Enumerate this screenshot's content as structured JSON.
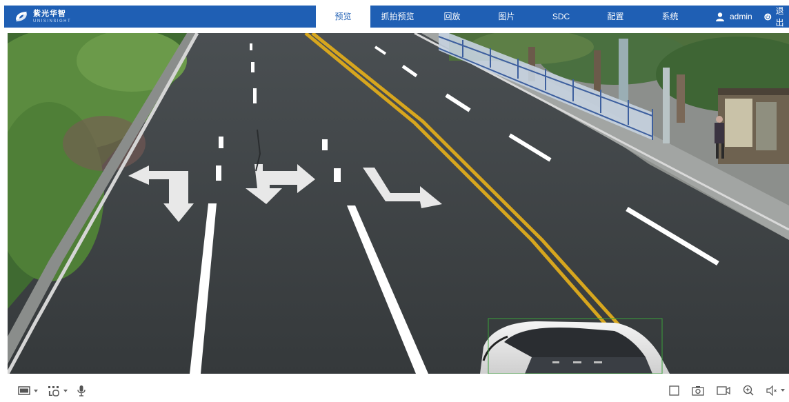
{
  "brand": {
    "name_cn": "紫光华智",
    "name_en": "UNISINSIGHT",
    "color": "#1f5fb4"
  },
  "nav": {
    "items": [
      {
        "label": "预览",
        "active": true
      },
      {
        "label": "抓拍预览",
        "active": false
      },
      {
        "label": "回放",
        "active": false
      },
      {
        "label": "图片",
        "active": false
      },
      {
        "label": "SDC",
        "active": false
      },
      {
        "label": "配置",
        "active": false
      },
      {
        "label": "系统",
        "active": false
      }
    ]
  },
  "user": {
    "name": "admin",
    "logout_label": "退出",
    "icons": [
      "user-icon",
      "power-icon"
    ]
  },
  "video": {
    "detection_box_color": "#3aa13a"
  },
  "toolbar": {
    "left_icons": [
      "stream-select-icon",
      "layout-select-icon",
      "microphone-icon"
    ],
    "right_icons": [
      "window-icon",
      "snapshot-icon",
      "record-icon",
      "zoom-in-icon",
      "volume-icon"
    ]
  }
}
